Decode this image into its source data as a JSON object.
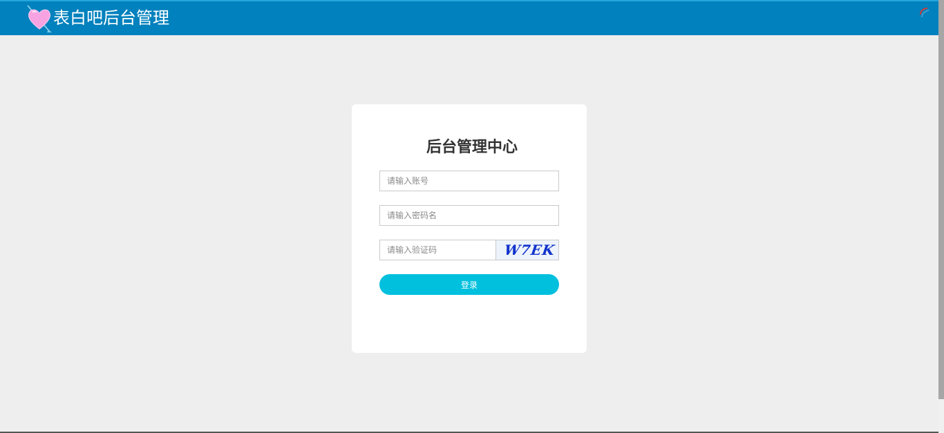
{
  "header": {
    "title": "表白吧后台管理",
    "logo_icon": "heart-arrow-icon",
    "corner_icon": "loading-arc-icon",
    "background_color": "#0181bd"
  },
  "login": {
    "title": "后台管理中心",
    "account_placeholder": "请输入账号",
    "password_placeholder": "请输入密码名",
    "captcha_placeholder": "请输入验证码",
    "captcha_text": "W7EK",
    "submit_label": "登录",
    "button_color": "#00c0de"
  }
}
